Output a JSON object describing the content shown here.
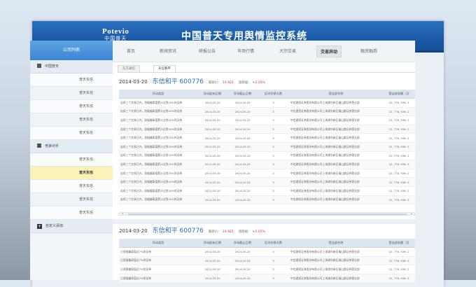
{
  "header": {
    "logo_en": "Potevio",
    "logo_cn": "中国普天",
    "title": "中国普天专用舆情监控系统"
  },
  "sidebar": {
    "heading": "公司列表",
    "groups": [
      {
        "label": "中国普天",
        "items": [
          "普天东信",
          "普天东信",
          "普天东信",
          "普天东信",
          "普天东信"
        ]
      },
      {
        "label": "竞争对手",
        "items": [
          "普天东信",
          "普天东信",
          "普天东信",
          "普天东信",
          "普天东信"
        ]
      }
    ],
    "active_item": "普天东信",
    "add_label": "自定义添加"
  },
  "nav": {
    "tabs": [
      "首页",
      "新闻资讯",
      "研报公告",
      "市场行情",
      "大宗交易",
      "交易异动",
      "融资融券"
    ],
    "active": "交易异动"
  },
  "subtabs": [
    "东方通信",
    "东信和平"
  ],
  "subtab_active": "东信和平",
  "blocks": [
    {
      "date": "2014-03-20",
      "stock": "东信和平 600776",
      "close_label": "最新价：",
      "close_value": "14.925",
      "change_label": "涨跌幅：",
      "change_value": "+2.05%",
      "columns": [
        "异动类型",
        "异动起始日期",
        "异动截止日期",
        "区间交易天数",
        "营业部名称",
        "营业部金额（万"
      ],
      "rows": [
        [
          "连续三个交易日内，涨幅偏离值累计达到20%的证券",
          "2014-03-20",
          "2014-03-20",
          "3",
          "中信建投证券股份有限公司上海浦东新区福山路证券营业部",
          "22, 776, 936. 2"
        ],
        [
          "连续三个交易日内，涨幅偏离值累计达到20%的证券",
          "2014-03-20",
          "2014-03-20",
          "3",
          "中信建投证券股份有限公司上海浦东新区福山路证券营业部",
          "22, 776, 936. 2"
        ],
        [
          "连续三个交易日内，涨幅偏离值累计达到20%的证券",
          "2014-03-20",
          "2014-03-20",
          "3",
          "中信建投证券股份有限公司上海浦东新区福山路证券营业部",
          "22, 776, 936. 2"
        ],
        [
          "连续三个交易日内，涨幅偏离值累计达到20%的证券",
          "2014-03-20",
          "2014-03-20",
          "3",
          "中信建投证券股份有限公司上海浦东新区福山路证券营业部",
          "22, 776, 936. 2"
        ],
        [
          "连续三个交易日内，涨幅偏离值累计达到20%的证券",
          "2014-03-20",
          "2014-03-20",
          "3",
          "中信建投证券股份有限公司上海浦东新区福山路证券营业部",
          "22, 776, 936. 2"
        ],
        [
          "连续三个交易日内，涨幅偏离值累计达到20%的证券",
          "2014-03-20",
          "2014-03-20",
          "3",
          "中信建投证券股份有限公司上海浦东新区福山路证券营业部",
          "22, 776, 936. 2"
        ],
        [
          "连续三个交易日内，涨幅偏离值累计达到20%的证券",
          "2014-03-20",
          "2014-03-20",
          "3",
          "中信建投证券股份有限公司上海浦东新区福山路证券营业部",
          "22, 776, 936. 2"
        ],
        [
          "连续三个交易日内，涨幅偏离值累计达到20%的证券",
          "2014-03-20",
          "2014-03-20",
          "3",
          "中信建投证券股份有限公司上海浦东新区福山路证券营业部",
          "22, 776, 936. 2"
        ],
        [
          "连续三个交易日内，涨幅偏离值累计达到20%的证券",
          "2014-03-20",
          "2014-03-20",
          "3",
          "中信建投证券股份有限公司上海浦东新区福山路证券营业部",
          "22, 776, 936. 2"
        ],
        [
          "连续三个交易日内，涨幅偏离值累计达到20%的证券",
          "2014-03-20",
          "2014-03-20",
          "3",
          "中信建投证券股份有限公司上海浦东新区福山路证券营业部",
          "22, 776, 936. 2"
        ],
        [
          "连续三个交易日内，涨幅偏离值累计达到20%的证券",
          "2014-03-20",
          "2014-03-20",
          "3",
          "中信建投证券股份有限公司上海浦东新区福山路证券营业部",
          "22, 776, 936. 2"
        ],
        [
          "连续三个交易日内，涨幅偏离值累计达到20%的证券",
          "2014-03-20",
          "2014-03-20",
          "3",
          "中信建投证券股份有限公司上海浦东新区福山路证券营业部",
          "22, 776, 936. 2"
        ]
      ]
    },
    {
      "date": "2014-03-20",
      "stock": "东信和平 600776",
      "close_label": "最新价：",
      "close_value": "14.925",
      "change_label": "涨跌幅：",
      "change_value": "+2.05%",
      "columns": [
        "异动类型",
        "异动起始日期",
        "异动截止日期",
        "区间交易天数",
        "营业部名称",
        "营业部金额（万"
      ],
      "rows": [
        [
          "日涨幅偏离值达7%的证券",
          "2014-03-20",
          "2014-03-20",
          "3",
          "中信建投证券股份有限公司上海浦东新区福山路证券营业部",
          "22, 776, 936. 2"
        ],
        [
          "日涨幅偏离值达7%的证券",
          "2014-03-20",
          "2014-03-20",
          "3",
          "中信建投证券股份有限公司上海浦东新区福山路证券营业部",
          "22, 776, 936. 2"
        ],
        [
          "日涨幅偏离值达7%的证券",
          "2014-03-20",
          "2014-03-20",
          "3",
          "中信建投证券股份有限公司上海浦东新区福山路证券营业部",
          "22, 776, 936. 2"
        ],
        [
          "日涨幅偏离值达7%的证券",
          "2014-03-20",
          "2014-03-20",
          "3",
          "中信建投证券股份有限公司上海浦东新区福山路证券营业部",
          "22, 776, 936. 2"
        ]
      ]
    }
  ]
}
